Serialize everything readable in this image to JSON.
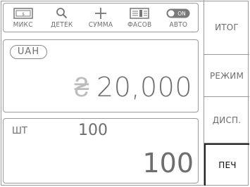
{
  "modes": [
    {
      "icon": "banknote-icon",
      "label": "МИКС"
    },
    {
      "icon": "search-icon",
      "label": "ДЕТЕК"
    },
    {
      "icon": "plus-icon",
      "label": "СУММА"
    },
    {
      "icon": "banknote-stack-icon",
      "label": "ФАСОВ"
    },
    {
      "icon": "toggle-on-icon",
      "label": "АВТО",
      "toggle_text": "ON"
    }
  ],
  "amount": {
    "currency": "UAH",
    "symbol": "₴",
    "value": "20,000"
  },
  "count": {
    "unit": "ШТ",
    "batch": "100",
    "total": "100"
  },
  "menu": {
    "total_label": "ИТОГ",
    "mode_label": "РЕЖИМ",
    "display_label": "ДИСП.",
    "print_label": "ПЕЧ"
  }
}
